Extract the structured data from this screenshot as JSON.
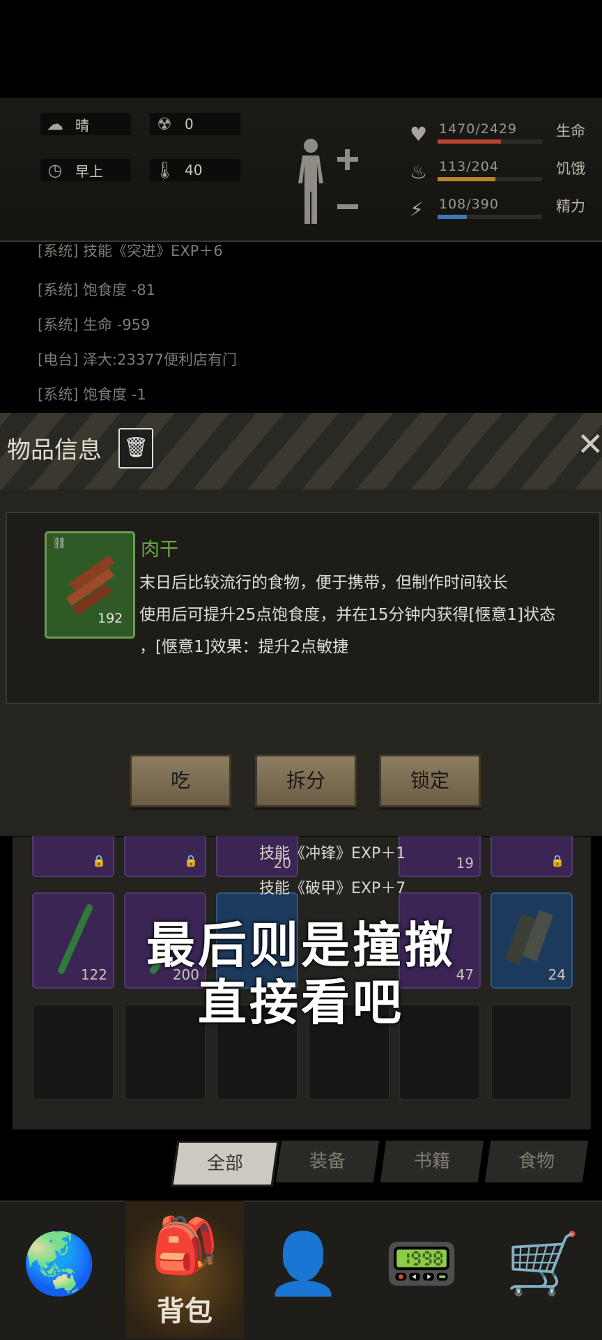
{
  "status": {
    "weather": {
      "icon": "cloud-sun-icon",
      "text": "晴"
    },
    "radiation": {
      "icon": "radiation-icon",
      "text": "0"
    },
    "time": {
      "icon": "clock-icon",
      "text": "早上"
    },
    "temperature": {
      "icon": "thermometer-icon",
      "text": "40"
    },
    "bars": [
      {
        "label": "生命",
        "value": "1470/2429",
        "fraction": 0.605,
        "color": "#b8432e",
        "icon": "heart-icon"
      },
      {
        "label": "饥饿",
        "value": "113/204",
        "fraction": 0.554,
        "color": "#b9822d",
        "icon": "stomach-icon"
      },
      {
        "label": "精力",
        "value": "108/390",
        "fraction": 0.277,
        "color": "#3d78b3",
        "icon": "energy-icon"
      }
    ]
  },
  "log": [
    "[系统] 技能《突进》EXP＋6",
    "[系统] 饱食度 -81",
    "[系统] 生命 -959",
    "[电台] 泽大:23377便利店有门",
    "[系统] 饱食度 -1"
  ],
  "modal": {
    "title": "物品信息",
    "item": {
      "name": "肉干",
      "quantity": "192",
      "description": [
        "末日后比较流行的食物，便于携带，但制作时间较长",
        "使用后可提升25点饱食度，并在15分钟内获得[惬意1]状态",
        "，[惬意1]效果：提升2点敏捷"
      ]
    },
    "buttons": {
      "eat": "吃",
      "split": "拆分",
      "lock": "锁定"
    }
  },
  "inventory": {
    "row1_counts": [
      "",
      "",
      "20",
      "19",
      ""
    ],
    "row2_counts": [
      "122",
      "200",
      "47",
      "24"
    ]
  },
  "feed": [
    "技能《冲锋》EXP＋1",
    "技能《破甲》EXP＋7"
  ],
  "caption": [
    "最后则是撞撤",
    "直接看吧"
  ],
  "tabs": [
    "全部",
    "装备",
    "书籍",
    "食物"
  ],
  "nav": {
    "bag_label": "背包"
  }
}
